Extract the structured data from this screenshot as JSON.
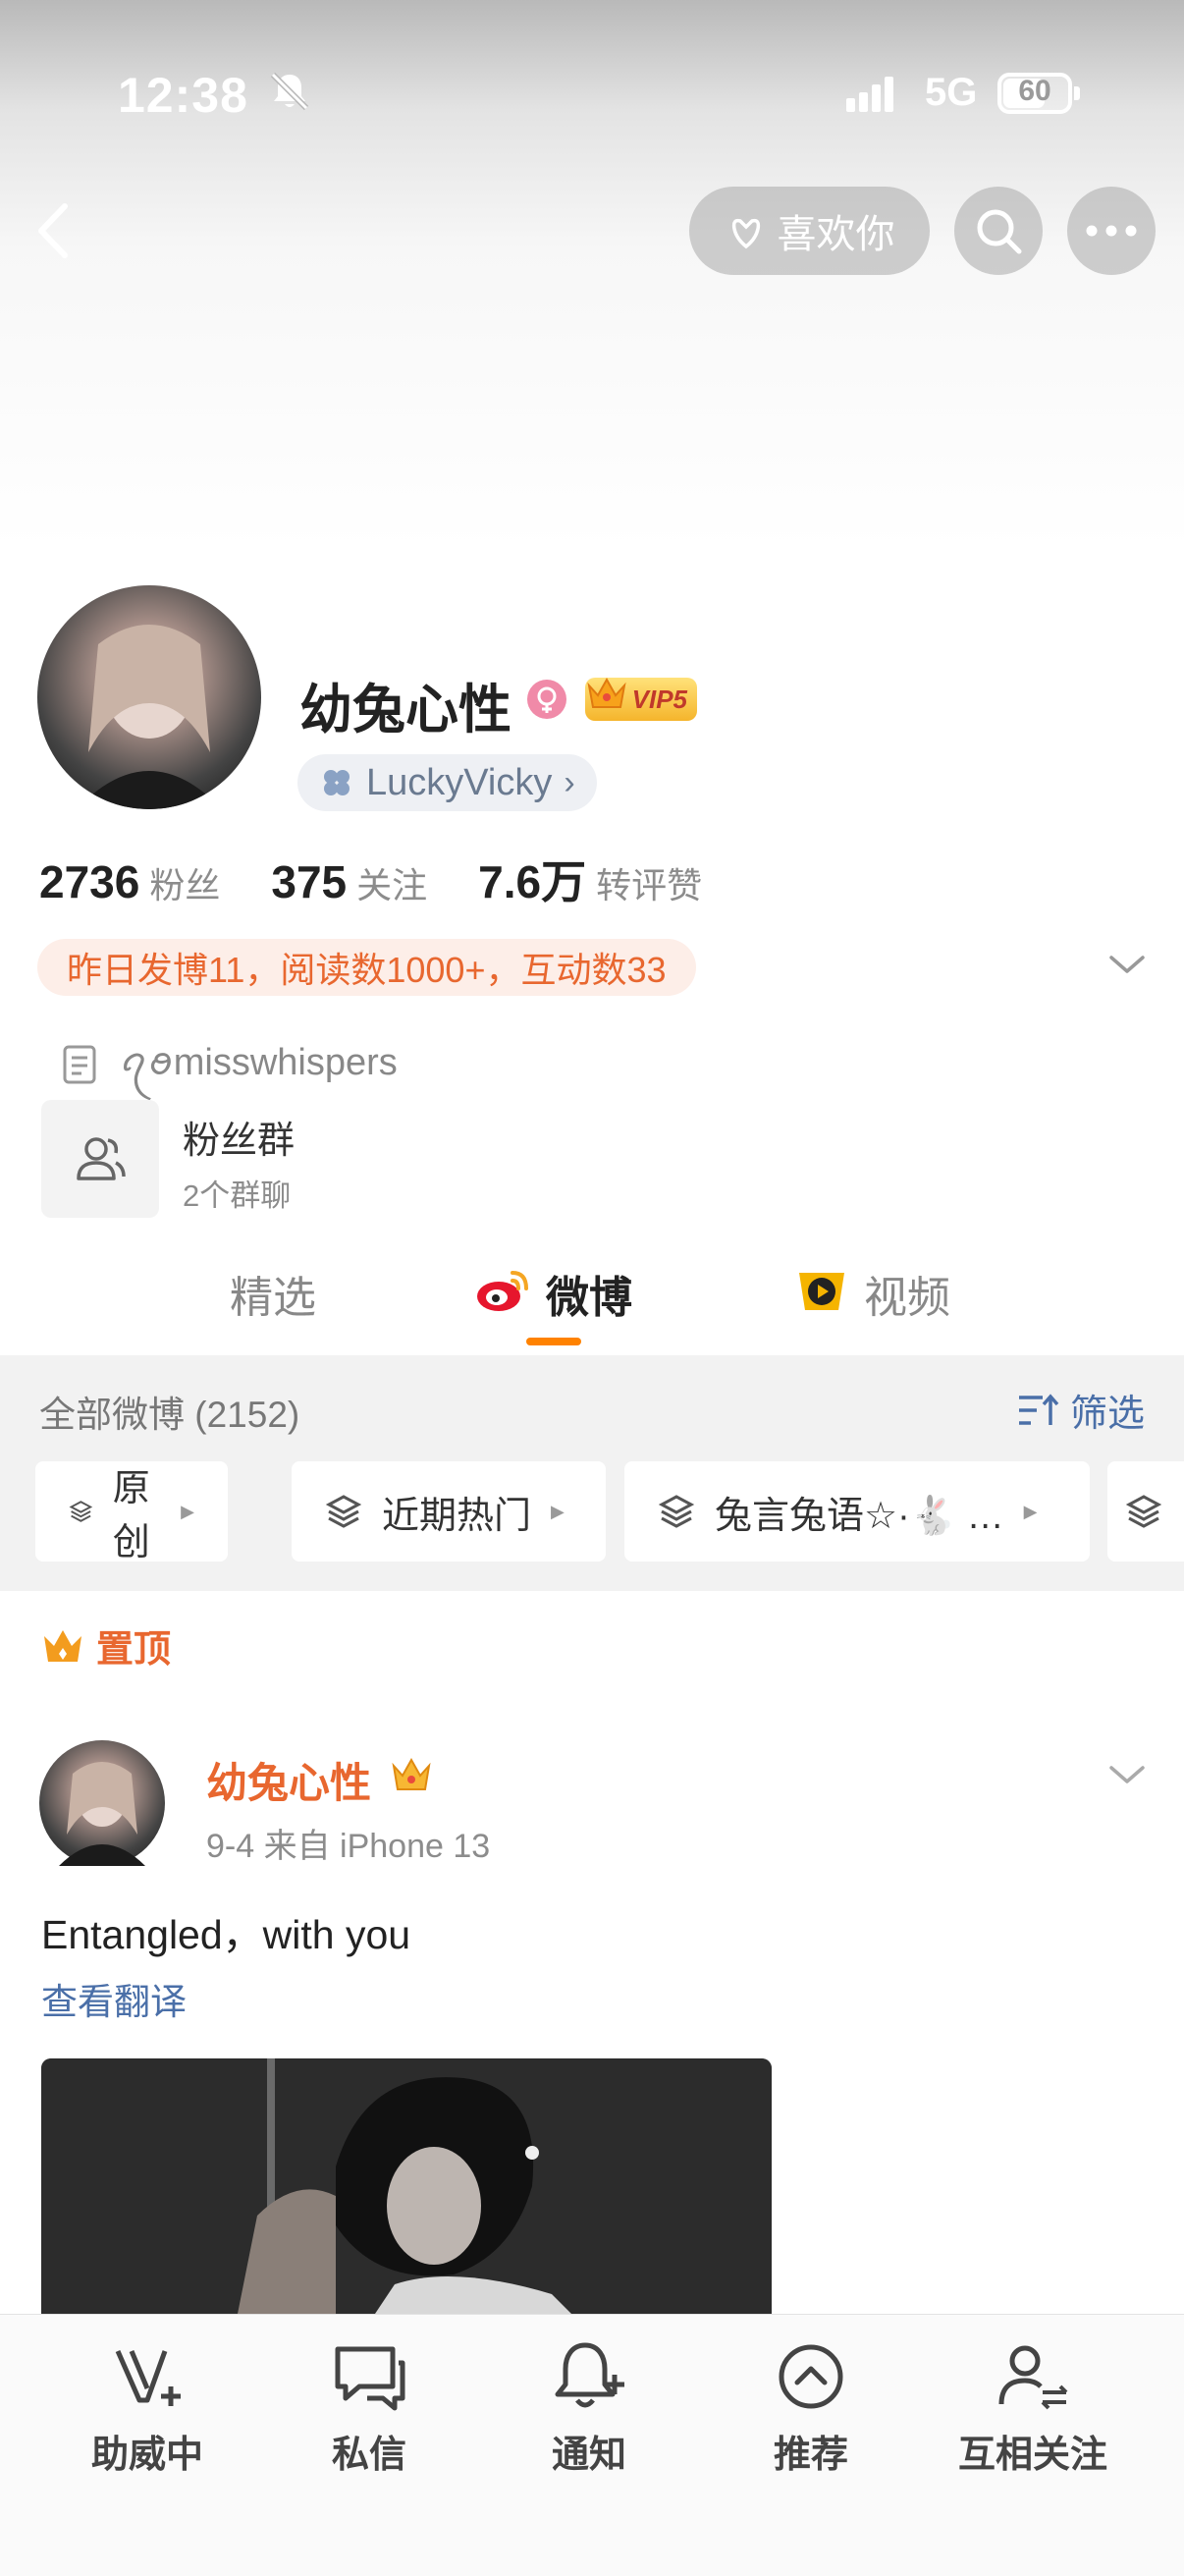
{
  "status_bar": {
    "time": "12:38",
    "network": "5G",
    "battery": "60"
  },
  "header": {
    "like_label": "喜欢你"
  },
  "profile": {
    "name": "幼兔心性",
    "vip_label": "VIP5",
    "badge_label": "LuckyVicky",
    "badge_arrow": "›",
    "stats": [
      {
        "value": "2736",
        "label": "粉丝"
      },
      {
        "value": "375",
        "label": "关注"
      },
      {
        "value": "7.6万",
        "label": "转评赞"
      }
    ],
    "activity": "昨日发博11，阅读数1000+，互动数33",
    "description": "ꪖꪮmisswhispers",
    "fan_group": {
      "title": "粉丝群",
      "subtitle": "2个群聊"
    }
  },
  "tabs": [
    {
      "label": "精选"
    },
    {
      "label": "微博"
    },
    {
      "label": "视频"
    }
  ],
  "filter": {
    "all_label": "全部微博 (2152)",
    "filter_label": "筛选",
    "chips": [
      {
        "label": "原创"
      },
      {
        "label": "近期热门"
      },
      {
        "label": "兔言兔语☆·🐇 …"
      }
    ]
  },
  "post": {
    "pinned_label": "置顶",
    "author": "幼兔心性",
    "meta": "9-4  来自 iPhone 13",
    "text": "Entangled，with you",
    "translate_label": "查看翻译"
  },
  "bottom_nav": [
    {
      "label": "助威中"
    },
    {
      "label": "私信"
    },
    {
      "label": "通知"
    },
    {
      "label": "推荐"
    },
    {
      "label": "互相关注"
    }
  ],
  "colors": {
    "accent_orange": "#e8672f",
    "tab_underline": "#ff8200",
    "link_blue": "#4a6fa8"
  }
}
